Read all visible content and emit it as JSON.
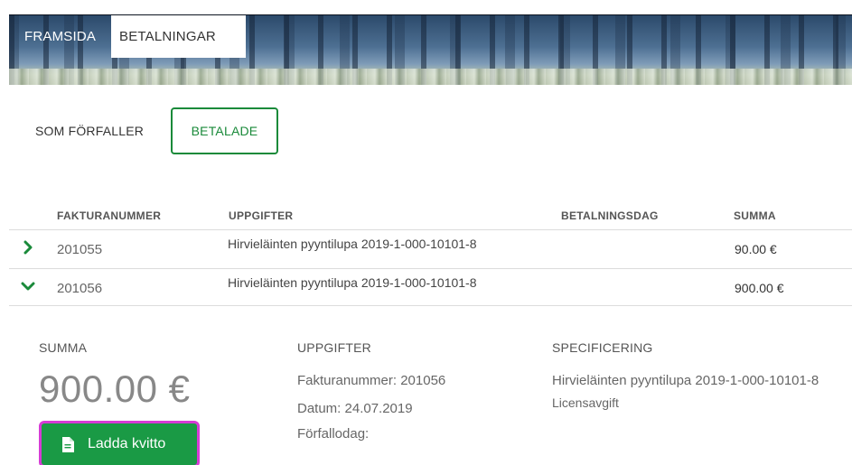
{
  "nav": {
    "tabs": [
      {
        "label": "FRAMSIDA"
      },
      {
        "label": "BETALNINGAR"
      }
    ]
  },
  "subtabs": [
    {
      "label": "SOM FÖRFALLER"
    },
    {
      "label": "BETALADE"
    }
  ],
  "table": {
    "headers": [
      "FAKTURANUMMER",
      "UPPGIFTER",
      "BETALNINGSDAG",
      "SUMMA"
    ],
    "rows": [
      {
        "invoice": "201055",
        "details": "Hirvieläinten pyyntilupa 2019-1-000-10101-8",
        "payment_day": "",
        "sum": "90.00 €",
        "expanded": false
      },
      {
        "invoice": "201056",
        "details": "Hirvieläinten pyyntilupa 2019-1-000-10101-8",
        "payment_day": "",
        "sum": "900.00 €",
        "expanded": true
      }
    ]
  },
  "detail": {
    "sum_label": "SUMMA",
    "sum_value": "900.00 €",
    "info_label": "UPPGIFTER",
    "invoice_number": "Fakturanummer: 201056",
    "date": "Datum: 24.07.2019",
    "due_date": "Förfallodag:",
    "spec_label": "SPECIFICERING",
    "spec_line1": "Hirvieläinten pyyntilupa 2019-1-000-10101-8",
    "spec_line2": "Licensavgift",
    "download_label": "Ladda kvitto"
  },
  "colors": {
    "accent_green": "#1a9a45",
    "highlight_border": "#d63bd6"
  },
  "icons": {
    "collapsed": "chevron-right-icon",
    "expanded": "chevron-down-icon",
    "download": "document-icon"
  }
}
